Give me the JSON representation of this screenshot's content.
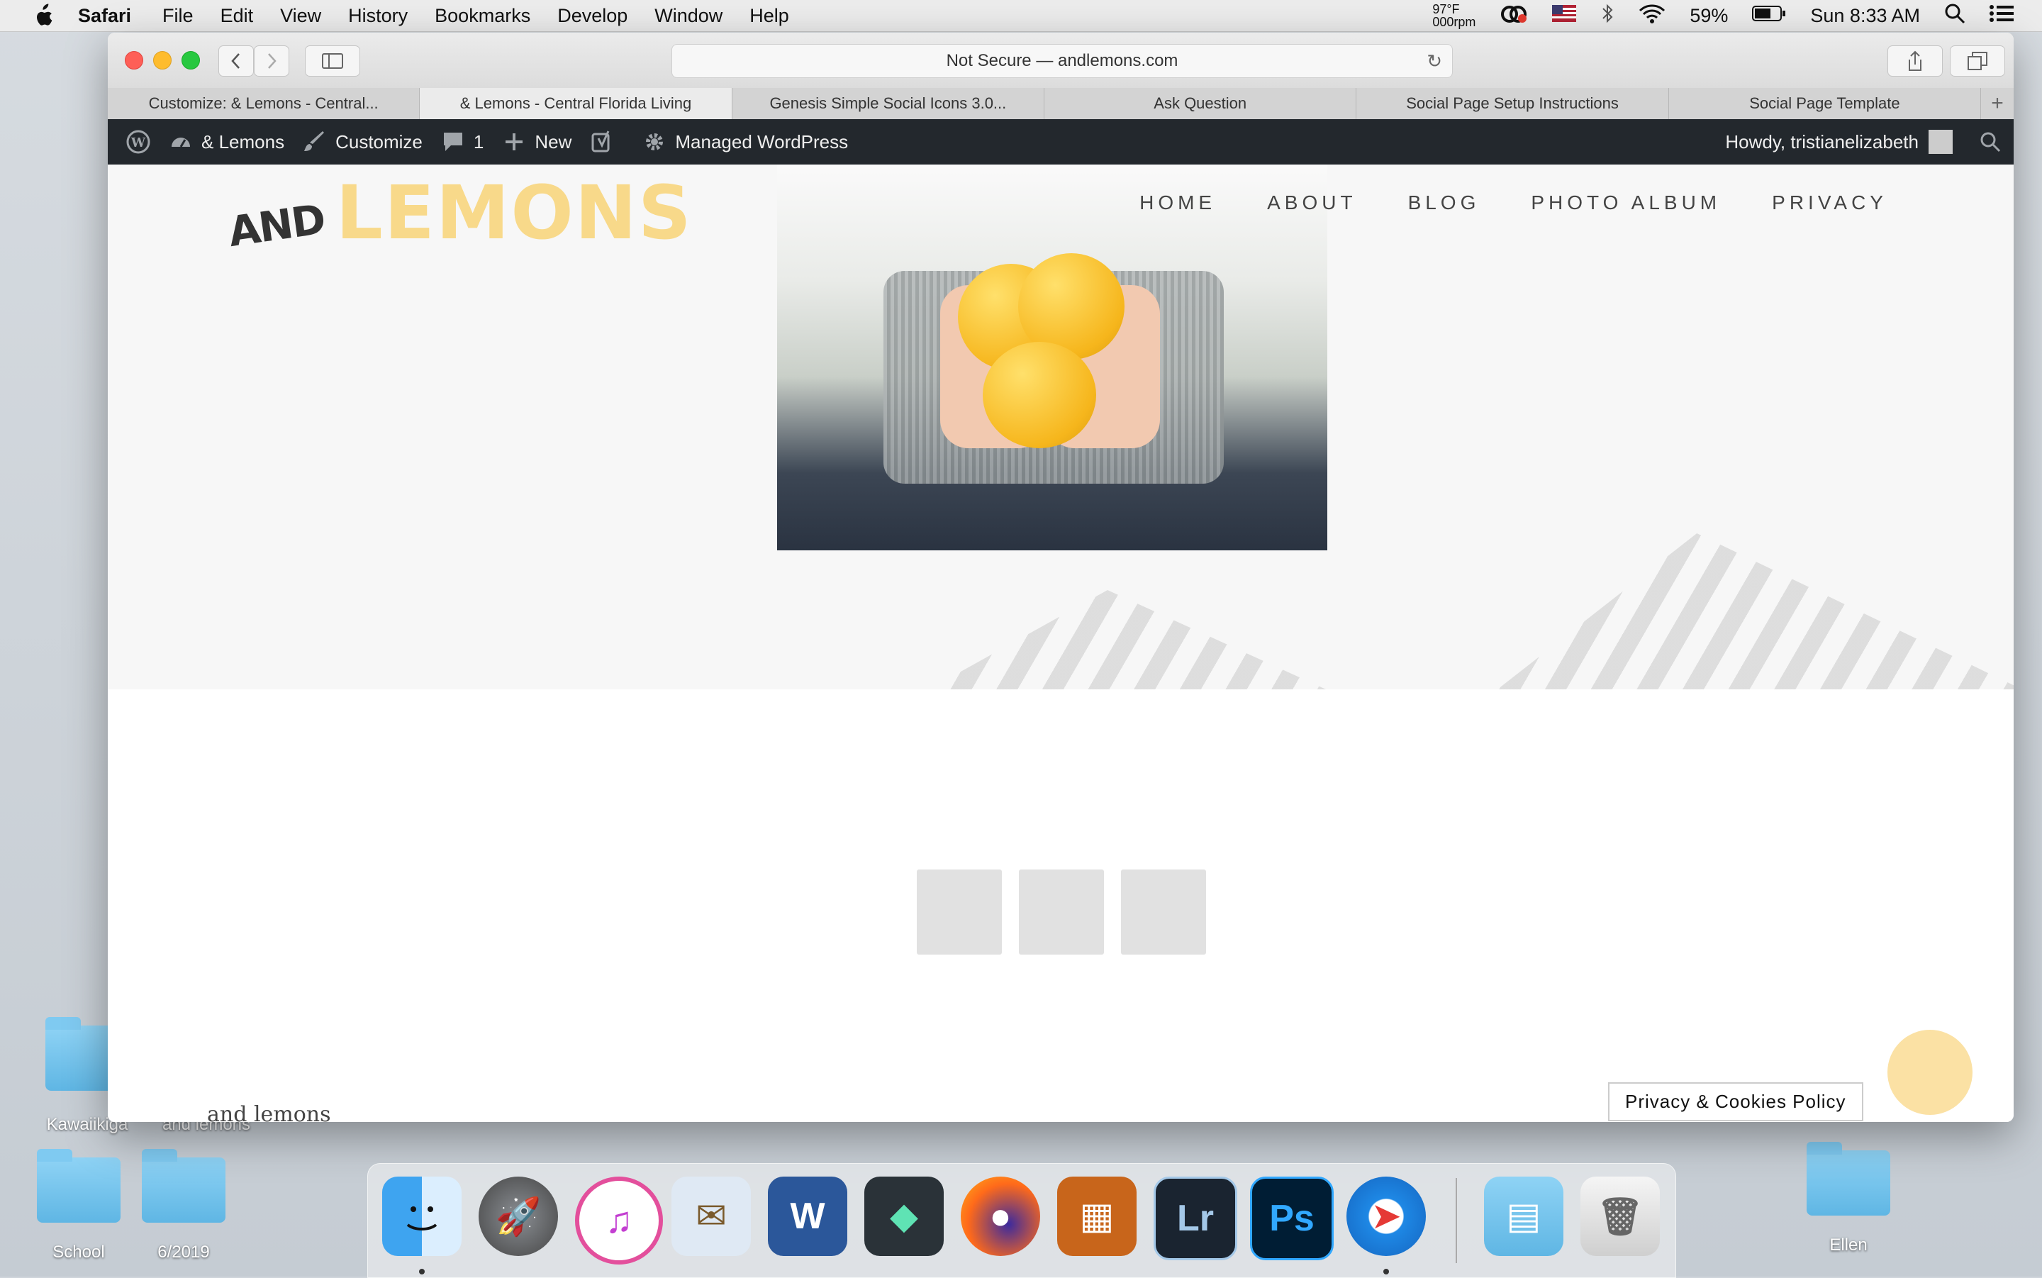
{
  "menubar": {
    "items": [
      "Safari",
      "File",
      "Edit",
      "View",
      "History",
      "Bookmarks",
      "Develop",
      "Window",
      "Help"
    ],
    "temp_top": "97°F",
    "temp_bottom": "000rpm",
    "battery": "59%",
    "clock": "Sun 8:33 AM"
  },
  "safari": {
    "address": "Not Secure — andlemons.com",
    "tabs": [
      "Customize: & Lemons - Central...",
      "& Lemons - Central Florida Living",
      "Genesis Simple Social Icons 3.0...",
      "Ask Question",
      "Social Page Setup Instructions",
      "Social Page Template"
    ],
    "active_tab_index": 1
  },
  "adminbar": {
    "site": "& Lemons",
    "customize": "Customize",
    "comments": "1",
    "new": "New",
    "managed": "Managed WordPress",
    "howdy": "Howdy, tristianelizabeth"
  },
  "site": {
    "logo_and": "AND",
    "logo_lemons": "LEMONS",
    "nav": [
      "HOME",
      "ABOUT",
      "BLOG",
      "PHOTO ALBUM",
      "PRIVACY"
    ],
    "footer_text": "and lemons",
    "privacy_button": "Privacy & Cookies Policy"
  },
  "desktop": {
    "icons": [
      "Kawaiikiga",
      "and lemons",
      "School",
      "6/2019",
      "Ellen"
    ]
  },
  "dock": [
    "Finder",
    "Launchpad",
    "iTunes",
    "Preview",
    "Word",
    "Filmora",
    "Firefox",
    "Keynote",
    "Lightroom",
    "Photoshop",
    "Safari",
    "Downloads",
    "Trash"
  ],
  "colors": {
    "adminbar": "#23282d",
    "logo_yellow": "#f8d98a",
    "accent_circle": "#fbe1a4"
  }
}
